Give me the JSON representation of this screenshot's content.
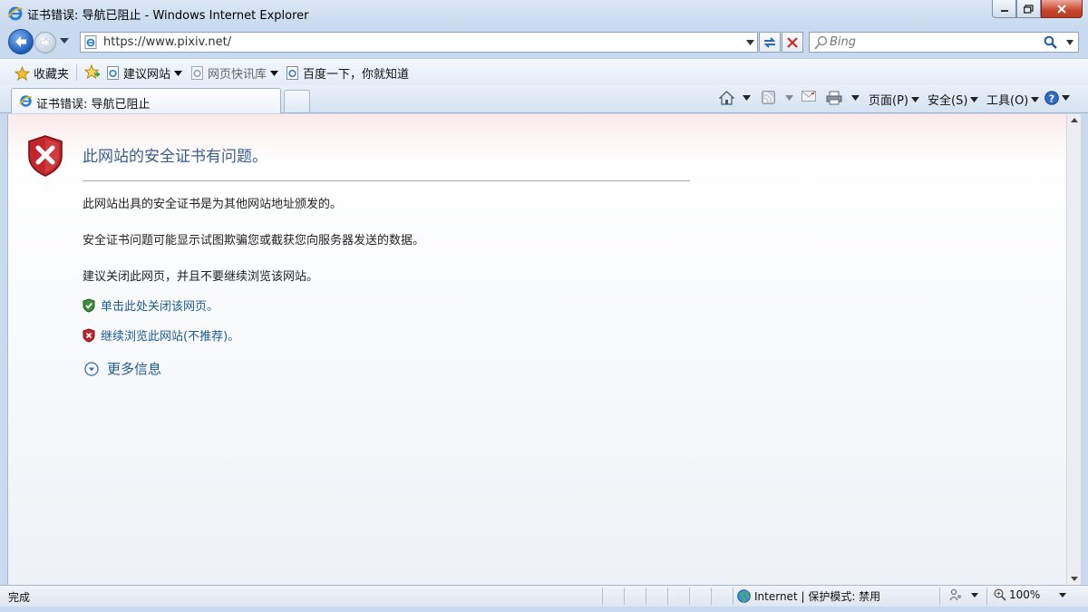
{
  "window": {
    "title": "证书错误: 导航已阻止 - Windows Internet Explorer"
  },
  "nav": {
    "url": "https://www.pixiv.net/",
    "search_placeholder": "Bing"
  },
  "favorites_bar": {
    "favorites_label": "收藏夹",
    "items": [
      {
        "label": "建议网站"
      },
      {
        "label": "网页快讯库"
      },
      {
        "label": "百度一下，你就知道"
      }
    ]
  },
  "tab": {
    "label": "证书错误: 导航已阻止"
  },
  "command_bar": {
    "page_label": "页面(P)",
    "safety_label": "安全(S)",
    "tools_label": "工具(O)"
  },
  "error_page": {
    "title": "此网站的安全证书有问题。",
    "para1": "此网站出具的安全证书是为其他网站地址颁发的。",
    "para2": "安全证书问题可能显示试图欺骗您或截获您向服务器发送的数据。",
    "para3": "建议关闭此网页，并且不要继续浏览该网站。",
    "close_link": "单击此处关闭该网页。",
    "continue_link": "继续浏览此网站(不推荐)。",
    "more_info": "更多信息"
  },
  "status_bar": {
    "ready": "完成",
    "zone": "Internet | 保护模式: 禁用",
    "zoom": "100%"
  },
  "colors": {
    "link": "#1a5d96",
    "title": "#3a5f8c",
    "error_red": "#c0262b",
    "safe_green": "#3c8f3c"
  }
}
